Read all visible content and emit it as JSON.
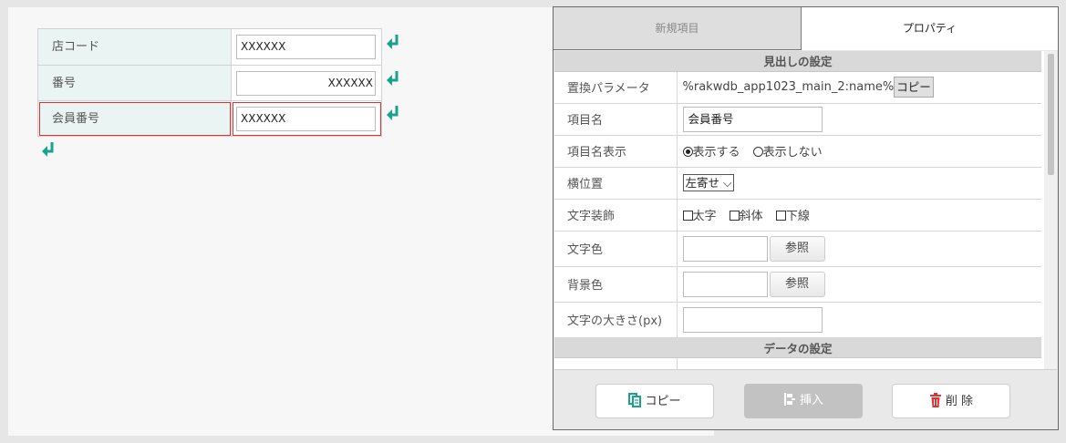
{
  "form": {
    "rows": [
      {
        "label": "店コード",
        "value": "XXXXXX"
      },
      {
        "label": "番号",
        "value": "XXXXXX"
      },
      {
        "label": "会員番号",
        "value": "XXXXXX"
      }
    ]
  },
  "icons": {
    "return": "return-arrow-icon",
    "copy": "copy-icon",
    "insert": "insert-icon",
    "delete": "trash-icon"
  },
  "colors": {
    "accent": "#1aa38c",
    "selection": "#dd3333",
    "delete_icon": "#dd3333"
  },
  "panel": {
    "tabs": {
      "new": "新規項目",
      "properties": "プロパティ"
    },
    "section_heading": "見出しの設定",
    "section_data": "データの設定",
    "props": {
      "param_label": "置換パラメータ",
      "param_value": "%rakwdb_app1023_main_2:name%",
      "param_copy": "コピー",
      "name_label": "項目名",
      "name_value": "会員番号",
      "show_label": "項目名表示",
      "show_on": "表示する",
      "show_off": "表示しない",
      "align_label": "横位置",
      "align_value": "左寄せ",
      "deco_label": "文字装飾",
      "deco_bold": "太字",
      "deco_italic": "斜体",
      "deco_underline": "下線",
      "color_label": "文字色",
      "bg_label": "背景色",
      "ref_button": "参照",
      "size_label": "文字の大きさ(px)"
    },
    "buttons": {
      "copy": "コピー",
      "insert": "挿入",
      "delete": "削 除"
    }
  }
}
